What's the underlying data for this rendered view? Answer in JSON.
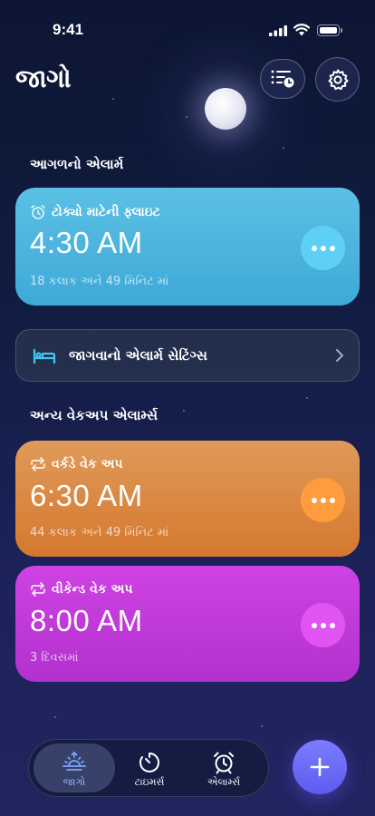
{
  "status_bar": {
    "time": "9:41"
  },
  "header": {
    "title": "જાગો"
  },
  "next_alarm": {
    "section_title": "આગળનો એલાર્મ",
    "label": "ટોક્યો માટેની ફ્લાઇટ",
    "time": "4:30 AM",
    "subtitle": "18 કલાક અને 49 મિનિટ માં",
    "color": "#4cb6e0"
  },
  "wake_settings": {
    "label": "જાગવાનો એલાર્મ સેટિંગ્સ"
  },
  "other_alarms": {
    "section_title": "અન્ય વેકઅપ એલાર્મ્સ",
    "items": [
      {
        "label": "વર્કડે વેક અપ",
        "time": "6:30 AM",
        "subtitle": "44 કલાક અને 49 મિનિટ માં",
        "color": "#d98a45",
        "icon": "repeat-icon"
      },
      {
        "label": "વીકેન્ડ વેક અપ",
        "time": "8:00 AM",
        "subtitle": "3 દિવસમાં",
        "color": "#c13ad9",
        "icon": "repeat-icon"
      }
    ]
  },
  "tabs": [
    {
      "label": "જાગો",
      "icon": "sunrise-icon",
      "active": true
    },
    {
      "label": "ટાઇમર્સ",
      "icon": "timer-icon",
      "active": false
    },
    {
      "label": "એલાર્મ્સ",
      "icon": "alarm-clock-icon",
      "active": false
    }
  ],
  "fab": {
    "label": "+"
  }
}
